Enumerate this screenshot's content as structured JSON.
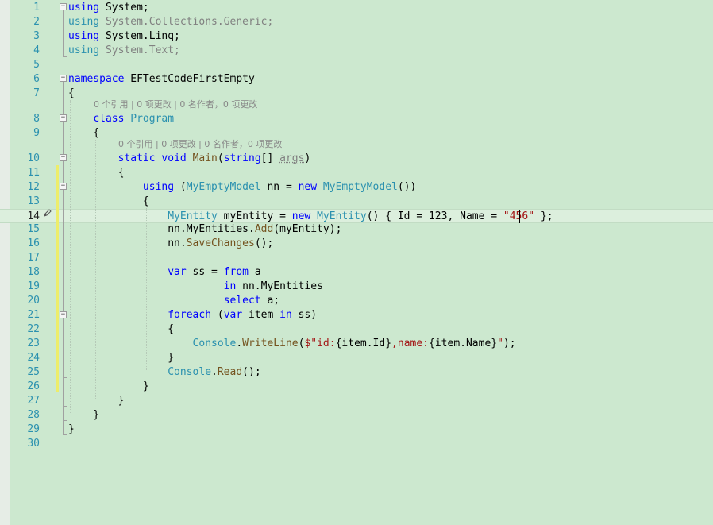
{
  "editor": {
    "lines": [
      {
        "n": "1",
        "tokens": [
          [
            "kw",
            "using"
          ],
          [
            "",
            "&nbsp;System;"
          ]
        ]
      },
      {
        "n": "2",
        "tokens": [
          [
            "ty",
            "using"
          ],
          [
            "dim",
            " System.Collections.Generic;"
          ]
        ]
      },
      {
        "n": "3",
        "tokens": [
          [
            "kw",
            "using"
          ],
          [
            "",
            " System.Linq;"
          ]
        ]
      },
      {
        "n": "4",
        "tokens": [
          [
            "ty",
            "using"
          ],
          [
            "dim",
            " System.Text;"
          ]
        ]
      },
      {
        "n": "5",
        "tokens": []
      },
      {
        "n": "6",
        "tokens": [
          [
            "kw",
            "namespace"
          ],
          [
            "",
            " EFTestCodeFirstEmpty"
          ]
        ]
      },
      {
        "n": "7",
        "tokens": [
          [
            "",
            "{"
          ]
        ]
      },
      {
        "n": "8",
        "tokens": [
          [
            "",
            "    "
          ],
          [
            "kw",
            "class"
          ],
          [
            "",
            " "
          ],
          [
            "ty",
            "Program"
          ]
        ]
      },
      {
        "n": "9",
        "tokens": [
          [
            "",
            "    {"
          ]
        ]
      },
      {
        "n": "10",
        "tokens": [
          [
            "",
            "        "
          ],
          [
            "kw",
            "static"
          ],
          [
            "",
            " "
          ],
          [
            "kw",
            "void"
          ],
          [
            "",
            " "
          ],
          [
            "mt",
            "Main"
          ],
          [
            "",
            "("
          ],
          [
            "kw",
            "string"
          ],
          [
            "",
            "[] "
          ],
          [
            "pm",
            "args"
          ],
          [
            "",
            ")"
          ]
        ]
      },
      {
        "n": "11",
        "tokens": [
          [
            "",
            "        {"
          ]
        ]
      },
      {
        "n": "12",
        "tokens": [
          [
            "",
            "            "
          ],
          [
            "kw",
            "using"
          ],
          [
            "",
            " ("
          ],
          [
            "ty",
            "MyEmptyModel"
          ],
          [
            "",
            " nn = "
          ],
          [
            "kw",
            "new"
          ],
          [
            "",
            " "
          ],
          [
            "ty",
            "MyEmptyModel"
          ],
          [
            "",
            "())"
          ]
        ]
      },
      {
        "n": "13",
        "tokens": [
          [
            "",
            "            {"
          ]
        ]
      },
      {
        "n": "14",
        "tokens": [
          [
            "",
            "                "
          ],
          [
            "ty",
            "MyEntity"
          ],
          [
            "",
            " myEntity = "
          ],
          [
            "kw",
            "new"
          ],
          [
            "",
            " "
          ],
          [
            "ty",
            "MyEntity"
          ],
          [
            "",
            "() { Id = 123, Name = "
          ],
          [
            "st",
            "\"456\""
          ],
          [
            "",
            " };"
          ]
        ]
      },
      {
        "n": "15",
        "tokens": [
          [
            "",
            "                nn.MyEntities."
          ],
          [
            "mt",
            "Add"
          ],
          [
            "",
            "(myEntity);"
          ]
        ]
      },
      {
        "n": "16",
        "tokens": [
          [
            "",
            "                nn."
          ],
          [
            "mt",
            "SaveChanges"
          ],
          [
            "",
            "();"
          ]
        ]
      },
      {
        "n": "17",
        "tokens": []
      },
      {
        "n": "18",
        "tokens": [
          [
            "",
            "                "
          ],
          [
            "kw",
            "var"
          ],
          [
            "",
            " ss = "
          ],
          [
            "kw",
            "from"
          ],
          [
            "",
            " a"
          ]
        ]
      },
      {
        "n": "19",
        "tokens": [
          [
            "",
            "                         "
          ],
          [
            "kw",
            "in"
          ],
          [
            "",
            " nn.MyEntities"
          ]
        ]
      },
      {
        "n": "20",
        "tokens": [
          [
            "",
            "                         "
          ],
          [
            "kw",
            "select"
          ],
          [
            "",
            " a;"
          ]
        ]
      },
      {
        "n": "21",
        "tokens": [
          [
            "",
            "                "
          ],
          [
            "kw",
            "foreach"
          ],
          [
            "",
            " ("
          ],
          [
            "kw",
            "var"
          ],
          [
            "",
            " item "
          ],
          [
            "kw",
            "in"
          ],
          [
            "",
            " ss)"
          ]
        ]
      },
      {
        "n": "22",
        "tokens": [
          [
            "",
            "                {"
          ]
        ]
      },
      {
        "n": "23",
        "tokens": [
          [
            "",
            "                    "
          ],
          [
            "ty",
            "Console"
          ],
          [
            "",
            "."
          ],
          [
            "mt",
            "WriteLine"
          ],
          [
            "",
            "("
          ],
          [
            "st",
            "$\"id:"
          ],
          [
            "",
            "{item.Id}"
          ],
          [
            "st",
            ",name:"
          ],
          [
            "",
            "{item.Name}"
          ],
          [
            "st",
            "\""
          ],
          [
            "",
            ");"
          ]
        ]
      },
      {
        "n": "24",
        "tokens": [
          [
            "",
            "                }"
          ]
        ]
      },
      {
        "n": "25",
        "tokens": [
          [
            "",
            "                "
          ],
          [
            "ty",
            "Console"
          ],
          [
            "",
            "."
          ],
          [
            "mt",
            "Read"
          ],
          [
            "",
            "();"
          ]
        ]
      },
      {
        "n": "26",
        "tokens": [
          [
            "",
            "            }"
          ]
        ]
      },
      {
        "n": "27",
        "tokens": [
          [
            "",
            "        }"
          ]
        ]
      },
      {
        "n": "28",
        "tokens": [
          [
            "",
            "    }"
          ]
        ]
      },
      {
        "n": "29",
        "tokens": [
          [
            "",
            "}"
          ]
        ]
      },
      {
        "n": "30",
        "tokens": []
      }
    ],
    "codelens_class": "0 个引用 | 0 项更改 | 0 名作者，0 项更改",
    "codelens_method": "0 个引用 | 0 项更改 | 0 名作者，0 项更改",
    "active_line": "14",
    "colors": {
      "background": "#cce8cf",
      "keyword": "#0000ff",
      "type": "#2b91af",
      "method": "#74531f",
      "string": "#a31515",
      "line_number": "#2b91af"
    }
  }
}
